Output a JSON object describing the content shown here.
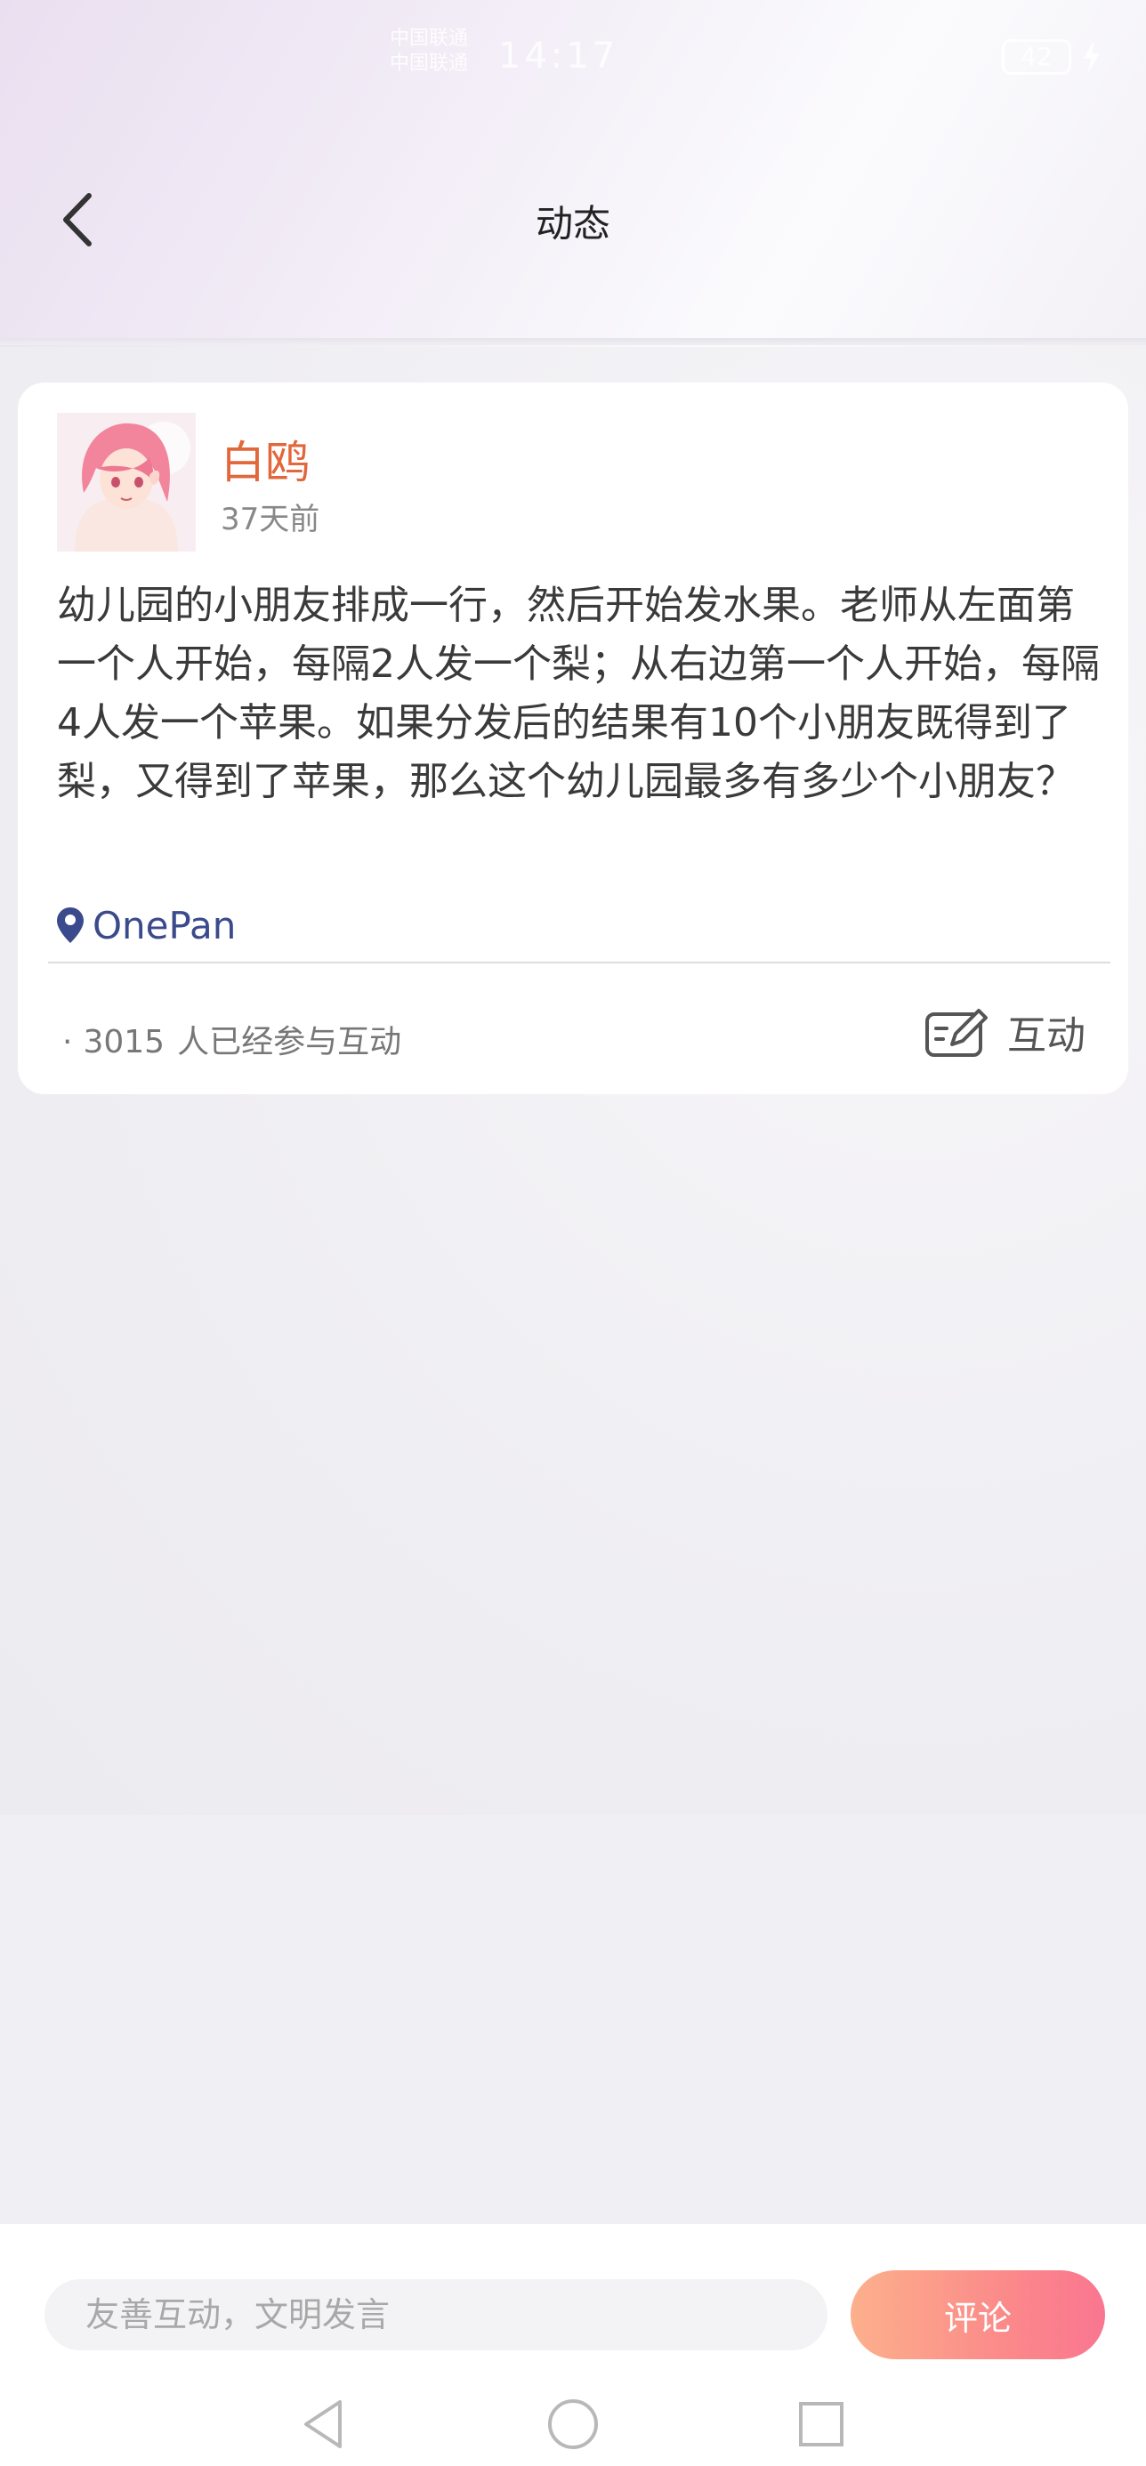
{
  "status_bar": {
    "carrier_line1": "中国联通",
    "carrier_line2": "中国联通",
    "time": "14:17",
    "battery": "42"
  },
  "header": {
    "title": "动态"
  },
  "post": {
    "username": "白鸥",
    "time_ago": "37天前",
    "content": "幼儿园的小朋友排成一行，然后开始发水果。老师从左面第一个人开始，每隔2人发一个梨；从右边第一个人开始，每隔4人发一个苹果。如果分发后的结果有10个小朋友既得到了梨，又得到了苹果，那么这个幼儿园最多有多少个小朋友？",
    "location": "OnePan",
    "participant_count": "3015",
    "participant_suffix": "人已经参与互动",
    "interact_label": "互动"
  },
  "bottom_bar": {
    "input_placeholder": "友善互动，文明发言",
    "comment_button": "评论"
  },
  "colors": {
    "username": "#e2673b",
    "location": "#3a4a8c",
    "comment_gradient_start": "#fcb08c",
    "comment_gradient_end": "#f97690"
  },
  "icons": [
    "back-arrow-icon",
    "location-pin-icon",
    "edit-note-icon",
    "charging-icon",
    "nav-back-icon",
    "nav-home-icon",
    "nav-recents-icon"
  ]
}
